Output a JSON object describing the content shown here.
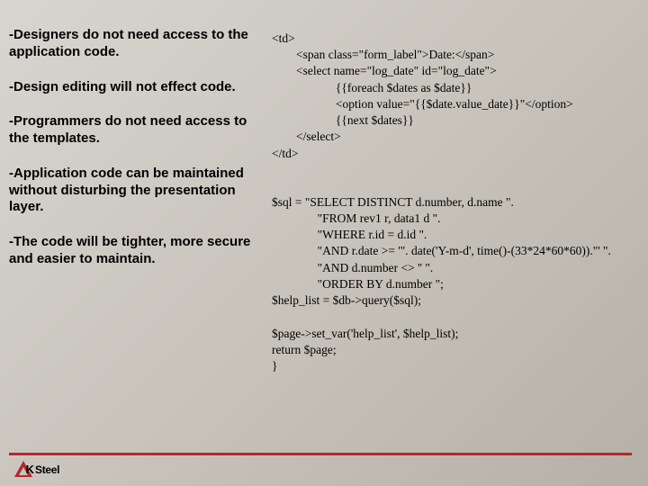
{
  "bullets": {
    "b0": "-Designers do not need access to the application code.",
    "b1": "-Design editing will not effect code.",
    "b2": "-Programmers do not need access to the templates.",
    "b3": "-Application code can be maintained without disturbing the presentation layer.",
    "b4": "-The code will be tighter, more secure and easier to maintain."
  },
  "code": {
    "block1": "<td>\n        <span class=\"form_label\">Date:</span>\n        <select name=\"log_date\" id=\"log_date\">\n                     {{foreach $dates as $date}}\n                     <option value=\"{{$date.value_date}}\"</option>\n                     {{next $dates}}\n        </select>\n</td>",
    "block2": "$sql = \"SELECT DISTINCT d.number, d.name \".\n               \"FROM rev1 r, data1 d \".\n               \"WHERE r.id = d.id \".\n               \"AND r.date >= '\". date('Y-m-d', time()-(33*24*60*60)).\"' \".\n               \"AND d.number <> '' \".\n               \"ORDER BY d.number \";\n$help_list = $db->query($sql);\n\n$page->set_var('help_list', $help_list);\nreturn $page;\n}"
  },
  "footer": {
    "logo_text": "Steel"
  }
}
